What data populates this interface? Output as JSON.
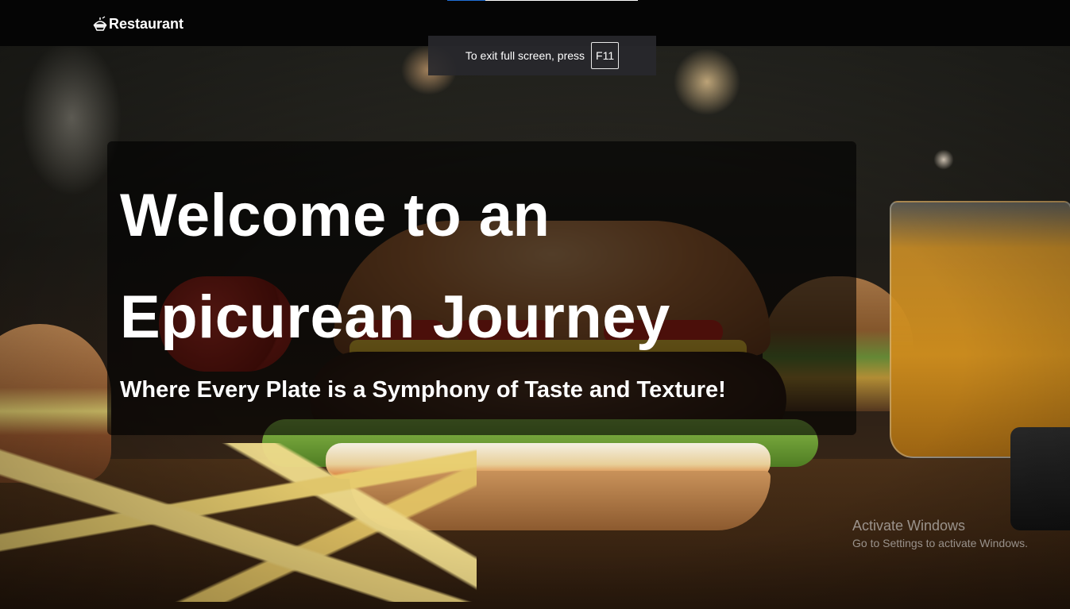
{
  "navbar": {
    "brand_label": "Restaurant",
    "brand_icon": "dish-icon",
    "top_progress": 0.2
  },
  "fullscreen_toast": {
    "message": "To exit full screen, press",
    "key": "F11"
  },
  "hero": {
    "title": "Welcome to an Epicurean Journey",
    "subtitle": "Where Every Plate is a Symphony of Taste and Texture!"
  },
  "watermark": {
    "title": "Activate Windows",
    "subtitle": "Go to Settings to activate Windows."
  },
  "colors": {
    "navbar_bg": "#050505",
    "card_bg": "rgba(0,0,0,0.62)",
    "text": "#ffffff",
    "progress_accent": "#1f6fd6"
  }
}
